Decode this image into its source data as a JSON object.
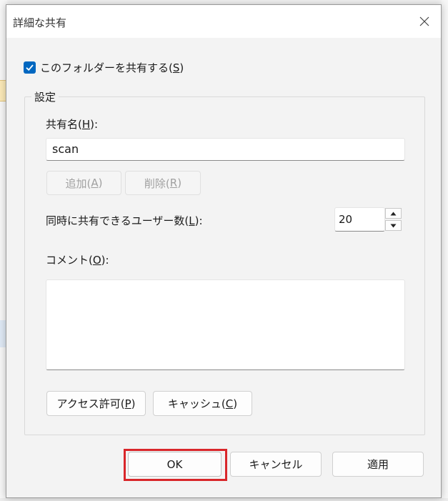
{
  "dialog": {
    "title": "詳細な共有",
    "close_icon": "close-icon"
  },
  "share_checkbox": {
    "checked": true,
    "label_pre": "このフォルダーを共有する(",
    "label_key": "S",
    "label_post": ")"
  },
  "settings": {
    "legend": "設定",
    "share_name": {
      "label_pre": "共有名(",
      "label_key": "H",
      "label_post": "):",
      "value": "scan"
    },
    "add": {
      "pre": "追加(",
      "key": "A",
      "post": ")"
    },
    "remove": {
      "pre": "削除(",
      "key": "R",
      "post": ")"
    },
    "user_limit": {
      "label_pre": "同時に共有できるユーザー数(",
      "label_key": "L",
      "label_post": "):",
      "value": "20"
    },
    "comment": {
      "label_pre": "コメント(",
      "label_key": "O",
      "label_post": "):",
      "value": ""
    },
    "permissions": {
      "pre": "アクセス許可(",
      "key": "P",
      "post": ")"
    },
    "caching": {
      "pre": "キャッシュ(",
      "key": "C",
      "post": ")"
    }
  },
  "footer": {
    "ok": "OK",
    "cancel": "キャンセル",
    "apply": "適用"
  },
  "colors": {
    "accent": "#0067c0",
    "highlight": "#d9262a",
    "dialog_bg": "#f3f3f3"
  }
}
